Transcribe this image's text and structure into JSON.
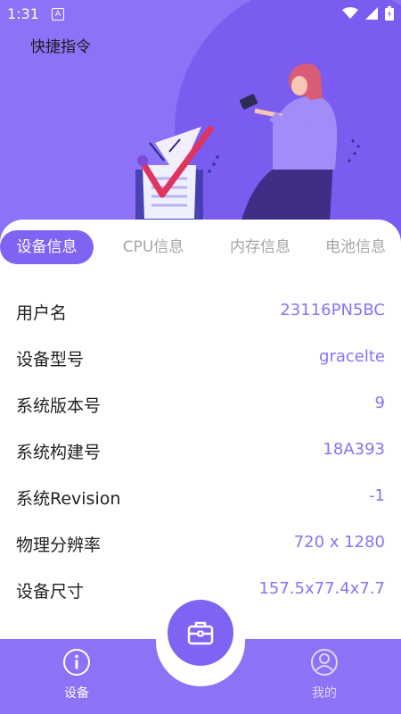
{
  "status": {
    "time": "1:31",
    "app_icon": "A"
  },
  "hero": {
    "title": "快捷指令"
  },
  "tabs": [
    {
      "label": "设备信息",
      "active": true
    },
    {
      "label": "CPU信息",
      "active": false
    },
    {
      "label": "内存信息",
      "active": false
    },
    {
      "label": "电池信息",
      "active": false
    }
  ],
  "device_info": [
    {
      "label": "用户名",
      "value": "23116PN5BC"
    },
    {
      "label": "设备型号",
      "value": "gracelte"
    },
    {
      "label": "系统版本号",
      "value": "9"
    },
    {
      "label": "系统构建号",
      "value": "18A393"
    },
    {
      "label": "系统Revision",
      "value": "-1"
    },
    {
      "label": "物理分辨率",
      "value": "720 x 1280"
    },
    {
      "label": "设备尺寸",
      "value": "157.5x77.4x7.7"
    }
  ],
  "nav": {
    "device": {
      "label": "设备",
      "icon": "info-icon"
    },
    "center": {
      "icon": "briefcase-icon"
    },
    "mine": {
      "label": "我的",
      "icon": "user-icon"
    }
  },
  "colors": {
    "accent": "#7f63f3",
    "hero_bg": "#8c72f6",
    "value_text": "#8b72f4",
    "inactive_text": "#a5a5a5"
  }
}
